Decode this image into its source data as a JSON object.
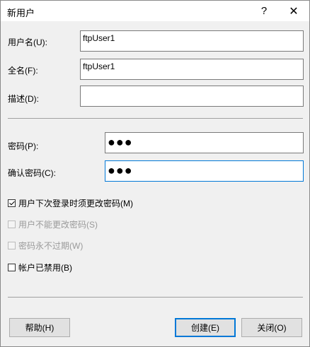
{
  "window": {
    "title": "新用户",
    "help_symbol": "?",
    "close_symbol": "✕"
  },
  "form": {
    "username_label": "用户名(U):",
    "username_value": "ftpUser1",
    "fullname_label": "全名(F):",
    "fullname_value": "ftpUser1",
    "description_label": "描述(D):",
    "description_value": "",
    "password_label": "密码(P):",
    "password_value": "●●●",
    "confirm_label": "确认密码(C):",
    "confirm_value": "●●●"
  },
  "options": [
    {
      "label": "用户下次登录时须更改密码(M)",
      "checked": true,
      "enabled": true
    },
    {
      "label": "用户不能更改密码(S)",
      "checked": false,
      "enabled": false
    },
    {
      "label": "密码永不过期(W)",
      "checked": false,
      "enabled": false
    },
    {
      "label": "帐户已禁用(B)",
      "checked": false,
      "enabled": true
    }
  ],
  "buttons": {
    "help": "帮助(H)",
    "create": "创建(E)",
    "close": "关闭(O)"
  }
}
